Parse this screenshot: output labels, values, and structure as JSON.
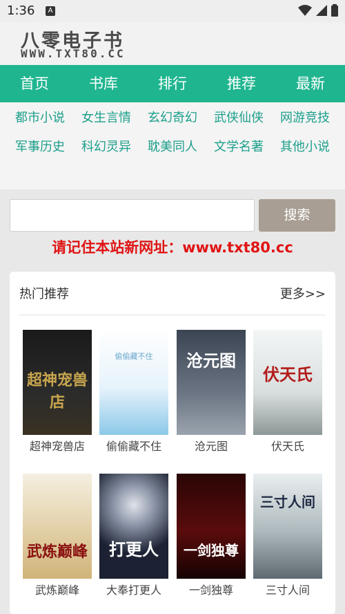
{
  "status": {
    "time": "1:36",
    "notif_icon": "A"
  },
  "site": {
    "title": "八零电子书",
    "url": "WWW.TXT80.CC"
  },
  "nav": [
    "首页",
    "书库",
    "排行",
    "推荐",
    "最新"
  ],
  "categories_row1": [
    "都市小说",
    "女生言情",
    "玄幻奇幻",
    "武侠仙侠",
    "网游竞技"
  ],
  "categories_row2": [
    "军事历史",
    "科幻灵异",
    "耽美同人",
    "文学名著",
    "其他小说"
  ],
  "search": {
    "button": "搜索",
    "value": ""
  },
  "notice": "请记住本站新网址：www.txt80.cc",
  "panel": {
    "title": "热门推荐",
    "more": "更多>>"
  },
  "books": [
    {
      "name": "超神宠兽店",
      "cover_text": "超神宠兽店"
    },
    {
      "name": "偷偷藏不住",
      "cover_text": "偷偷藏不住"
    },
    {
      "name": "沧元图",
      "cover_text": "沧元图"
    },
    {
      "name": "伏天氏",
      "cover_text": "伏天氏"
    },
    {
      "name": "武炼巅峰",
      "cover_text": "武炼巅峰"
    },
    {
      "name": "大奉打更人",
      "cover_text": "打更人"
    },
    {
      "name": "一剑独尊",
      "cover_text": "一剑独尊"
    },
    {
      "name": "三寸人间",
      "cover_text": "三寸人间"
    }
  ],
  "colors": {
    "nav_bg": "#1fb58f",
    "category_text": "#1c9f8a",
    "notice": "#e01414",
    "search_button": "#a89e93"
  }
}
